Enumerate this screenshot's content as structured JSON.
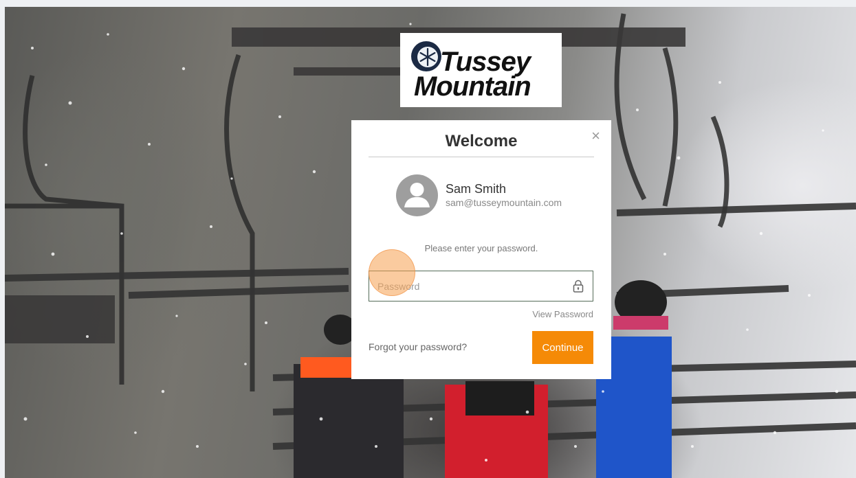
{
  "logo": {
    "line1": "Tussey",
    "line2": "Mountain"
  },
  "dialog": {
    "title": "Welcome",
    "close_symbol": "×",
    "user": {
      "name": "Sam Smith",
      "email": "sam@tusseymountain.com"
    },
    "prompt": "Please enter your password.",
    "password": {
      "placeholder": "Password",
      "value": ""
    },
    "view_password_label": "View Password",
    "forgot_label": "Forgot your password?",
    "continue_label": "Continue"
  },
  "icons": {
    "close": "close-icon",
    "avatar": "user-avatar-icon",
    "lock": "lock-icon",
    "logo": "snowflake-logo-icon"
  },
  "colors": {
    "accent": "#f58a07",
    "field_border": "#546b58",
    "title_text": "#333333"
  }
}
